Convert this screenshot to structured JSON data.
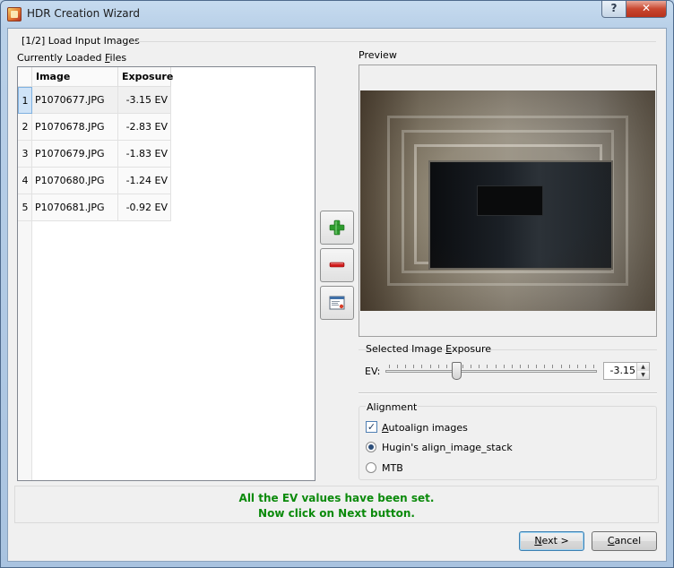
{
  "window": {
    "title": "HDR Creation Wizard"
  },
  "titlebar": {
    "help_glyph": "?",
    "close_glyph": "✕"
  },
  "step": {
    "label": "[1/2] Load Input Images"
  },
  "files": {
    "label": "Currently Loaded Files",
    "columns": [
      "Image Filename",
      "Exposure"
    ],
    "rows": [
      {
        "num": "1",
        "filename": "P1070677.JPG",
        "exposure": "-3.15 EV"
      },
      {
        "num": "2",
        "filename": "P1070678.JPG",
        "exposure": "-2.83 EV"
      },
      {
        "num": "3",
        "filename": "P1070679.JPG",
        "exposure": "-1.83 EV"
      },
      {
        "num": "4",
        "filename": "P1070680.JPG",
        "exposure": "-1.24 EV"
      },
      {
        "num": "5",
        "filename": "P1070681.JPG",
        "exposure": "-0.92 EV"
      }
    ],
    "selected_row": 0
  },
  "side_buttons": {
    "add_icon": "plus-icon",
    "remove_icon": "minus-icon",
    "edit_icon": "image-info-icon"
  },
  "preview": {
    "label": "Preview"
  },
  "exposure": {
    "group_label": "Selected Image Exposure",
    "ev_label": "EV:",
    "value": "-3.15",
    "slider_level": 0.33
  },
  "alignment": {
    "group_label": "Alignment",
    "autoalign_label": "Autoalign images",
    "autoalign_checked": true,
    "check_glyph": "✓",
    "options": [
      "Hugin's align_image_stack",
      "MTB"
    ],
    "selected_option": 0
  },
  "status": {
    "line1": "All the EV values have been set.",
    "line2": "Now click on Next button."
  },
  "buttons": {
    "next": "Next >",
    "cancel": "Cancel"
  },
  "colors": {
    "status_text": "#0b8a0b",
    "plus": "#2e9b2e",
    "minus": "#d01b1b",
    "selection": "#cfe3f7"
  }
}
